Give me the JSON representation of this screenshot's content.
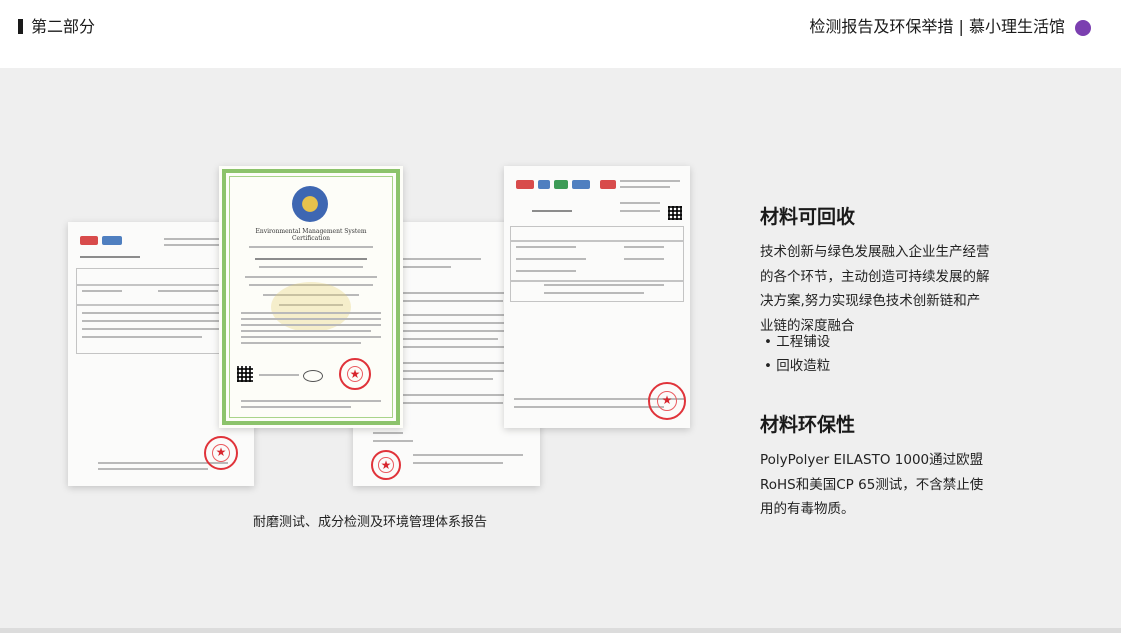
{
  "header": {
    "section_label": "第二部分",
    "title": "检测报告及环保举措 | 慕小理生活馆",
    "accent_color": "#7b3fb0"
  },
  "gallery": {
    "caption": "耐磨测试、成分检测及环境管理体系报告",
    "certificate_heading": "Environmental Management System Certification",
    "stamp_color": "#e0333a",
    "frame_color": "#8cc36b"
  },
  "recycle": {
    "heading": "材料可回收",
    "body": "技术创新与绿色发展融入企业生产经营的各个环节，主动创造可持续发展的解决方案,努力实现绿色技术创新链和产业链的深度融合",
    "bullets": [
      "工程铺设",
      "回收造粒"
    ]
  },
  "eco": {
    "heading": "材料环保性",
    "body": "PolyPolyer EILASTO 1000通过欧盟RoHS和美国CP 65测试，不含禁止使用的有毒物质。"
  },
  "icons": {
    "section_mark": "section-bar-icon",
    "accent": "purple-dot-icon",
    "bullet": "bullet-dot-icon"
  }
}
